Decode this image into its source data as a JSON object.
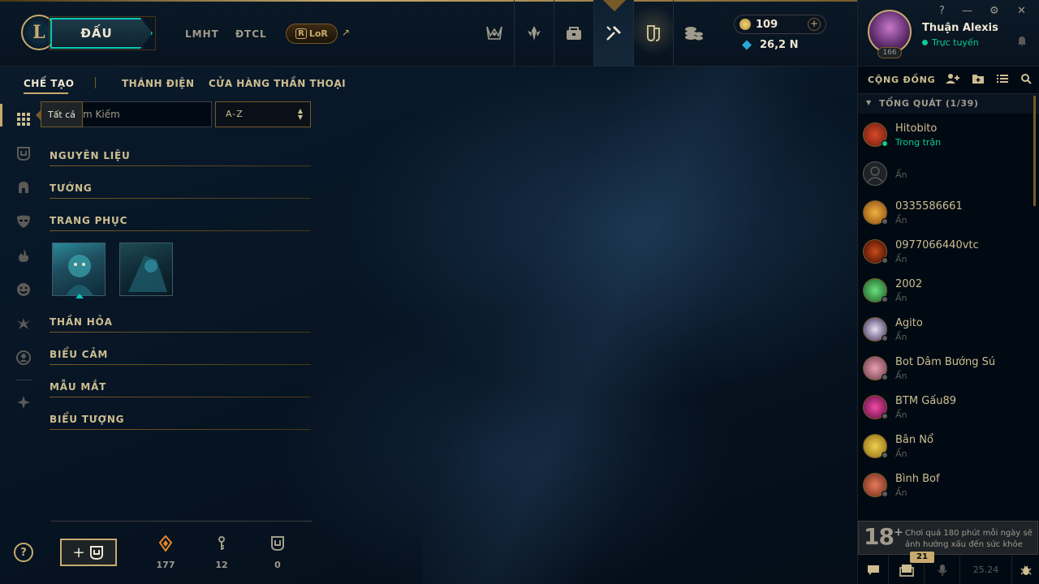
{
  "header": {
    "logo_letter": "L",
    "play_label": "ĐẤU",
    "nav": [
      "LMHT",
      "ĐTCL"
    ],
    "lor": {
      "badge": "R",
      "label": "LoR",
      "external": "↗"
    },
    "top_icons": [
      "trophy-icon",
      "ranked-emblem-icon",
      "inventory-chest-icon",
      "crafting-hammer-icon",
      "collection-icon",
      "store-coins-icon"
    ],
    "rp": {
      "value": "109",
      "plus": "+"
    },
    "blue_essence": {
      "value": "26,2 N"
    }
  },
  "profile": {
    "name": "Thuận Alexis",
    "status": "Trực tuyến",
    "level": "166",
    "window_controls": [
      "?",
      "—",
      "⚙",
      "✕"
    ]
  },
  "subnav": {
    "tabs": [
      "CHẾ TẠO",
      "THÁNH ĐIỆN",
      "CỬA HÀNG THẦN THOẠI"
    ],
    "active": "CHẾ TẠO"
  },
  "filter": {
    "tooltip": "Tất cả",
    "search_placeholder": "Tìm Kiếm",
    "search_visible": "m Kiếm",
    "sort": "A-Z",
    "sort_arrows": [
      "▲",
      "▼"
    ]
  },
  "categories": [
    "NGUYÊN LIỆU",
    "TƯỚNG",
    "TRANG PHỤC",
    "THẦN HỎA",
    "BIỂU CẢM",
    "MẪU MẮT",
    "BIỂU TƯỢNG"
  ],
  "footer": {
    "help": "?",
    "add_chest": "+",
    "stats": [
      {
        "icon": "orange-essence-icon",
        "value": "177"
      },
      {
        "icon": "key-fragment-icon",
        "value": "12"
      },
      {
        "icon": "chest-icon",
        "value": "0"
      }
    ]
  },
  "social": {
    "title": "CỘNG ĐỒNG",
    "group": "TỔNG QUÁT (1/39)",
    "friends": [
      {
        "name": "Hitobito",
        "status": "Trong trận",
        "online": true,
        "color": "#b8321e"
      },
      {
        "name": "",
        "status": "Ẩn",
        "online": false,
        "color": ""
      },
      {
        "name": "0335586661",
        "status": "Ẩn",
        "online": false,
        "color": "#d88a20"
      },
      {
        "name": "0977066440vtc",
        "status": "Ẩn",
        "online": false,
        "color": "#8a2a10"
      },
      {
        "name": "2002",
        "status": "Ẩn",
        "online": false,
        "color": "#3aaa5a"
      },
      {
        "name": "Agito",
        "status": "Ẩn",
        "online": false,
        "color": "#4a3a6a"
      },
      {
        "name": "Bot Dâm Bướng Sú",
        "status": "Ẩn",
        "online": false,
        "color": "#c86a7a"
      },
      {
        "name": "BTM Gấu89",
        "status": "Ẩn",
        "online": false,
        "color": "#c82a8a"
      },
      {
        "name": "Bân Nổ",
        "status": "Ẩn",
        "online": false,
        "color": "#d8a030"
      },
      {
        "name": "Bình Bof",
        "status": "Ẩn",
        "online": false,
        "color": "#c84a3a"
      }
    ],
    "warning": {
      "age": "18",
      "plus": "+",
      "text": "Chơi quá 180 phút mỗi ngày sẽ ảnh hưởng xấu đến sức khỏe"
    },
    "badge_count": "21",
    "version": "25.24"
  }
}
